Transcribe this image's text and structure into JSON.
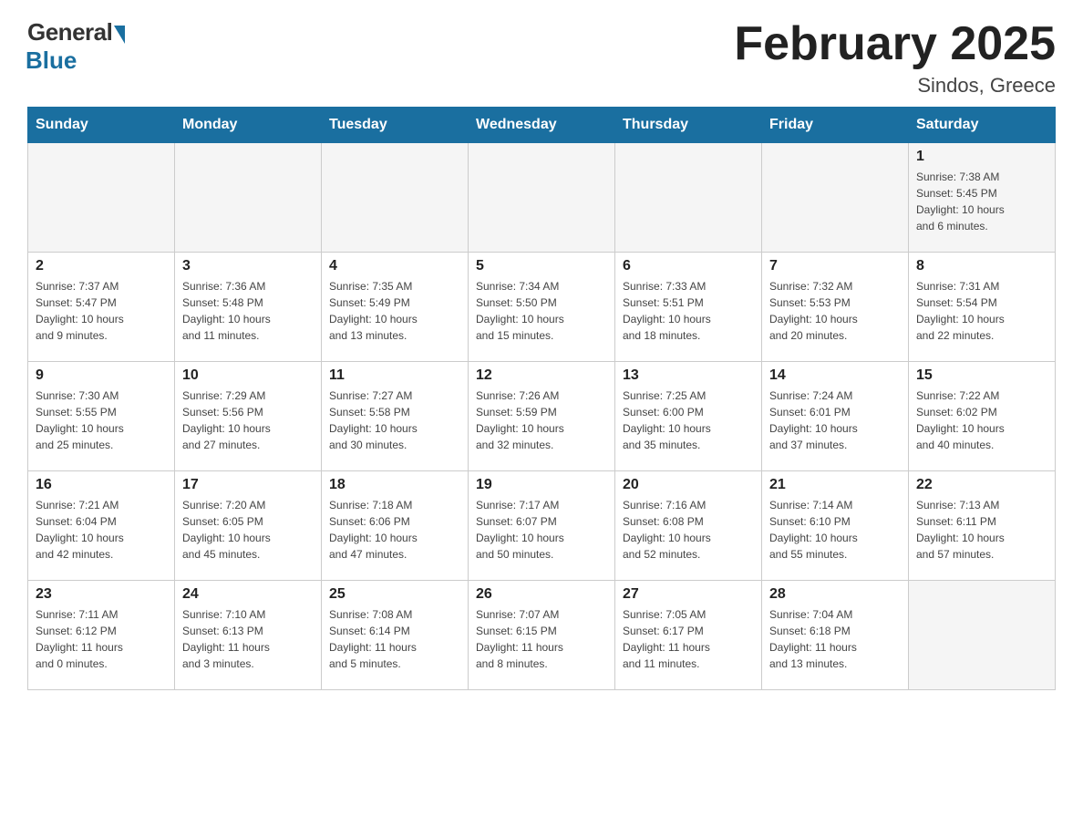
{
  "header": {
    "logo_general": "General",
    "logo_blue": "Blue",
    "title": "February 2025",
    "location": "Sindos, Greece"
  },
  "days_of_week": [
    "Sunday",
    "Monday",
    "Tuesday",
    "Wednesday",
    "Thursday",
    "Friday",
    "Saturday"
  ],
  "weeks": [
    {
      "days": [
        {
          "num": "",
          "info": ""
        },
        {
          "num": "",
          "info": ""
        },
        {
          "num": "",
          "info": ""
        },
        {
          "num": "",
          "info": ""
        },
        {
          "num": "",
          "info": ""
        },
        {
          "num": "",
          "info": ""
        },
        {
          "num": "1",
          "info": "Sunrise: 7:38 AM\nSunset: 5:45 PM\nDaylight: 10 hours\nand 6 minutes."
        }
      ]
    },
    {
      "days": [
        {
          "num": "2",
          "info": "Sunrise: 7:37 AM\nSunset: 5:47 PM\nDaylight: 10 hours\nand 9 minutes."
        },
        {
          "num": "3",
          "info": "Sunrise: 7:36 AM\nSunset: 5:48 PM\nDaylight: 10 hours\nand 11 minutes."
        },
        {
          "num": "4",
          "info": "Sunrise: 7:35 AM\nSunset: 5:49 PM\nDaylight: 10 hours\nand 13 minutes."
        },
        {
          "num": "5",
          "info": "Sunrise: 7:34 AM\nSunset: 5:50 PM\nDaylight: 10 hours\nand 15 minutes."
        },
        {
          "num": "6",
          "info": "Sunrise: 7:33 AM\nSunset: 5:51 PM\nDaylight: 10 hours\nand 18 minutes."
        },
        {
          "num": "7",
          "info": "Sunrise: 7:32 AM\nSunset: 5:53 PM\nDaylight: 10 hours\nand 20 minutes."
        },
        {
          "num": "8",
          "info": "Sunrise: 7:31 AM\nSunset: 5:54 PM\nDaylight: 10 hours\nand 22 minutes."
        }
      ]
    },
    {
      "days": [
        {
          "num": "9",
          "info": "Sunrise: 7:30 AM\nSunset: 5:55 PM\nDaylight: 10 hours\nand 25 minutes."
        },
        {
          "num": "10",
          "info": "Sunrise: 7:29 AM\nSunset: 5:56 PM\nDaylight: 10 hours\nand 27 minutes."
        },
        {
          "num": "11",
          "info": "Sunrise: 7:27 AM\nSunset: 5:58 PM\nDaylight: 10 hours\nand 30 minutes."
        },
        {
          "num": "12",
          "info": "Sunrise: 7:26 AM\nSunset: 5:59 PM\nDaylight: 10 hours\nand 32 minutes."
        },
        {
          "num": "13",
          "info": "Sunrise: 7:25 AM\nSunset: 6:00 PM\nDaylight: 10 hours\nand 35 minutes."
        },
        {
          "num": "14",
          "info": "Sunrise: 7:24 AM\nSunset: 6:01 PM\nDaylight: 10 hours\nand 37 minutes."
        },
        {
          "num": "15",
          "info": "Sunrise: 7:22 AM\nSunset: 6:02 PM\nDaylight: 10 hours\nand 40 minutes."
        }
      ]
    },
    {
      "days": [
        {
          "num": "16",
          "info": "Sunrise: 7:21 AM\nSunset: 6:04 PM\nDaylight: 10 hours\nand 42 minutes."
        },
        {
          "num": "17",
          "info": "Sunrise: 7:20 AM\nSunset: 6:05 PM\nDaylight: 10 hours\nand 45 minutes."
        },
        {
          "num": "18",
          "info": "Sunrise: 7:18 AM\nSunset: 6:06 PM\nDaylight: 10 hours\nand 47 minutes."
        },
        {
          "num": "19",
          "info": "Sunrise: 7:17 AM\nSunset: 6:07 PM\nDaylight: 10 hours\nand 50 minutes."
        },
        {
          "num": "20",
          "info": "Sunrise: 7:16 AM\nSunset: 6:08 PM\nDaylight: 10 hours\nand 52 minutes."
        },
        {
          "num": "21",
          "info": "Sunrise: 7:14 AM\nSunset: 6:10 PM\nDaylight: 10 hours\nand 55 minutes."
        },
        {
          "num": "22",
          "info": "Sunrise: 7:13 AM\nSunset: 6:11 PM\nDaylight: 10 hours\nand 57 minutes."
        }
      ]
    },
    {
      "days": [
        {
          "num": "23",
          "info": "Sunrise: 7:11 AM\nSunset: 6:12 PM\nDaylight: 11 hours\nand 0 minutes."
        },
        {
          "num": "24",
          "info": "Sunrise: 7:10 AM\nSunset: 6:13 PM\nDaylight: 11 hours\nand 3 minutes."
        },
        {
          "num": "25",
          "info": "Sunrise: 7:08 AM\nSunset: 6:14 PM\nDaylight: 11 hours\nand 5 minutes."
        },
        {
          "num": "26",
          "info": "Sunrise: 7:07 AM\nSunset: 6:15 PM\nDaylight: 11 hours\nand 8 minutes."
        },
        {
          "num": "27",
          "info": "Sunrise: 7:05 AM\nSunset: 6:17 PM\nDaylight: 11 hours\nand 11 minutes."
        },
        {
          "num": "28",
          "info": "Sunrise: 7:04 AM\nSunset: 6:18 PM\nDaylight: 11 hours\nand 13 minutes."
        },
        {
          "num": "",
          "info": ""
        }
      ]
    }
  ]
}
